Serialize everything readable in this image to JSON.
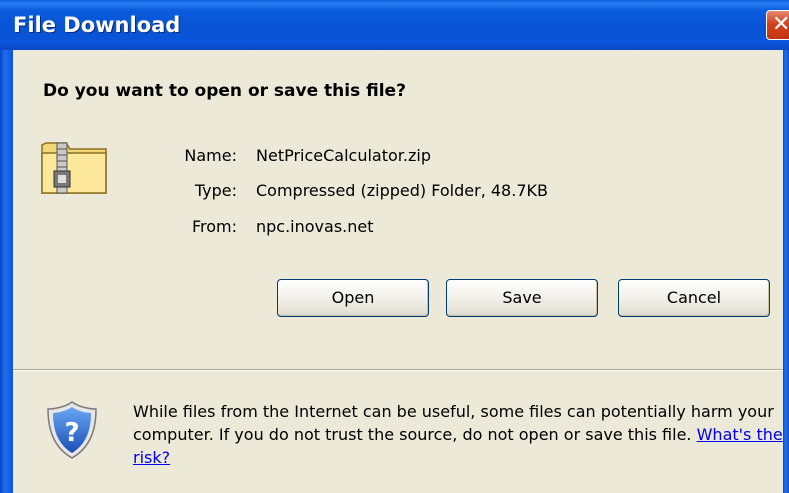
{
  "window": {
    "title": "File Download",
    "close_symbol": "✕"
  },
  "dialog": {
    "question": "Do you want to open or save this file?",
    "file_icon": "zip-folder-icon",
    "fields": [
      {
        "label": "Name:",
        "value": "NetPriceCalculator.zip"
      },
      {
        "label": "Type:",
        "value": "Compressed (zipped) Folder, 48.7KB"
      },
      {
        "label": "From:",
        "value": "npc.inovas.net"
      }
    ],
    "buttons": {
      "open": "Open",
      "save": "Save",
      "cancel": "Cancel"
    },
    "warning": {
      "icon": "shield-question-icon",
      "text": "While files from the Internet can be useful, some files can potentially harm your computer. If you do not trust the source, do not open or save this file.",
      "link": "What's the risk?"
    }
  },
  "colors": {
    "titlebar": "#0853d4",
    "dialog_background": "#ece9d8",
    "close_button": "#d2421f",
    "link": "#0000ee"
  }
}
